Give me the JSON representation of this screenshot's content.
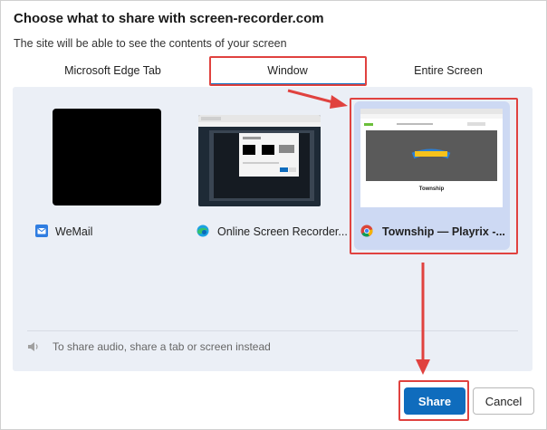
{
  "dialog": {
    "title": "Choose what to share with screen-recorder.com",
    "subtitle": "The site will be able to see the contents of your screen"
  },
  "tabs": [
    {
      "label": "Microsoft Edge Tab",
      "selected": false
    },
    {
      "label": "Window",
      "selected": true
    },
    {
      "label": "Entire Screen",
      "selected": false
    }
  ],
  "windows": [
    {
      "label": "WeMail",
      "icon": "mail-icon",
      "selected": false
    },
    {
      "label": "Online Screen Recorder...",
      "icon": "edge-icon",
      "selected": false
    },
    {
      "label": "Township — Playrix -...",
      "icon": "chrome-icon",
      "selected": true
    }
  ],
  "thumb_text": {
    "township_caption": "Township"
  },
  "audio_note": "To share audio, share a tab or screen instead",
  "buttons": {
    "share": "Share",
    "cancel": "Cancel"
  },
  "colors": {
    "accent": "#0f6cbd",
    "annotation": "#e0423f",
    "panel": "#ebeff6"
  }
}
